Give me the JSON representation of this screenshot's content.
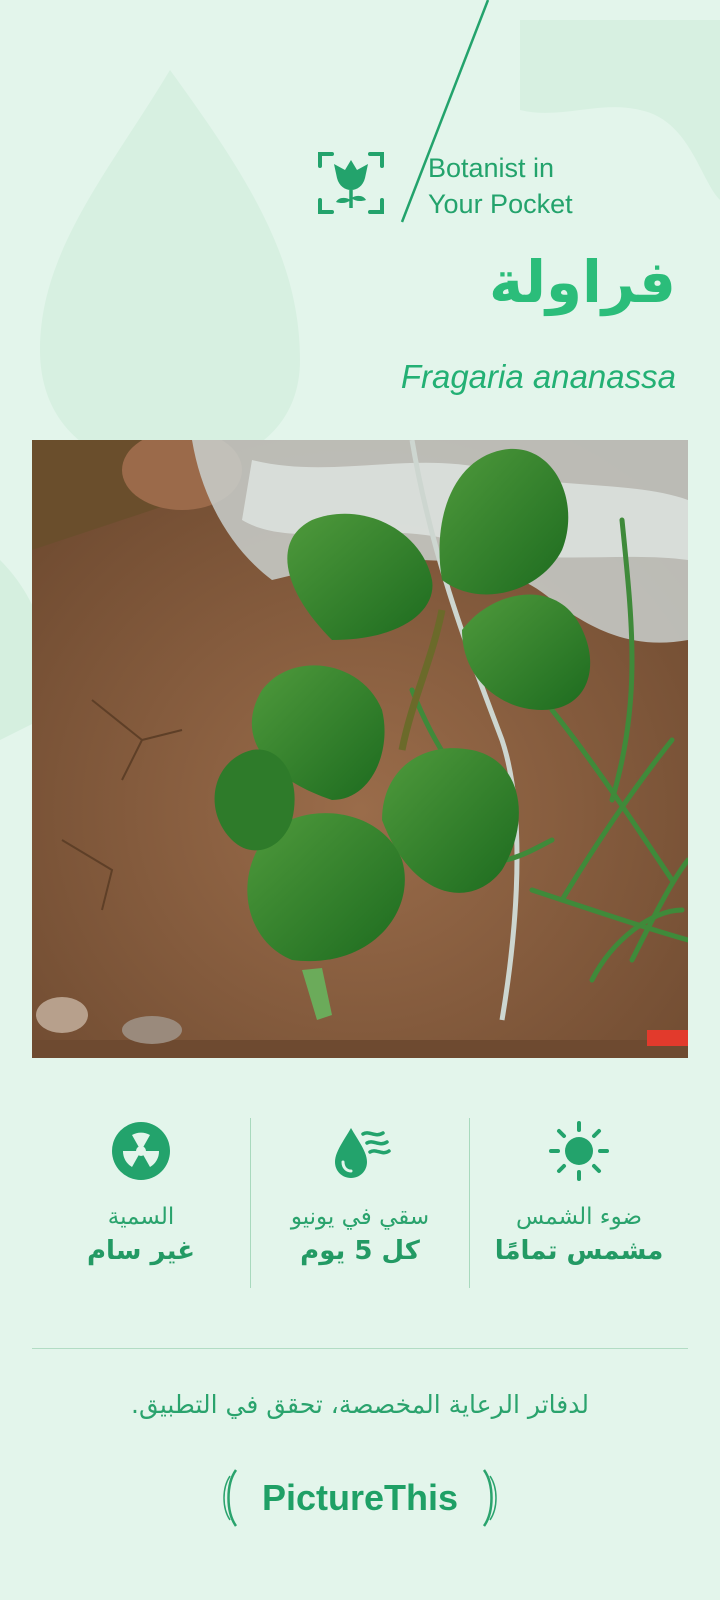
{
  "header": {
    "tagline": "Botanist in\nYour Pocket",
    "icon": "flower-scan-icon"
  },
  "plant": {
    "common_name": "فراولة",
    "scientific_name": "Fragaria ananassa"
  },
  "photo": {
    "subject": "strawberry-plant-photo"
  },
  "stats": [
    {
      "icon": "toxicity-icon",
      "label": "السمية",
      "value": "غير سام"
    },
    {
      "icon": "watering-icon",
      "label": "سقي في يونيو",
      "value": "كل 5 يوم"
    },
    {
      "icon": "sun-icon",
      "label": "ضوء الشمس",
      "value": "مشمس تمامًا"
    }
  ],
  "footer": {
    "note": "لدفاتر الرعاية المخصصة، تحقق في التطبيق.",
    "logo_text": "PictureThis"
  },
  "colors": {
    "background": "#e3f5eb",
    "accent": "#23b074"
  }
}
